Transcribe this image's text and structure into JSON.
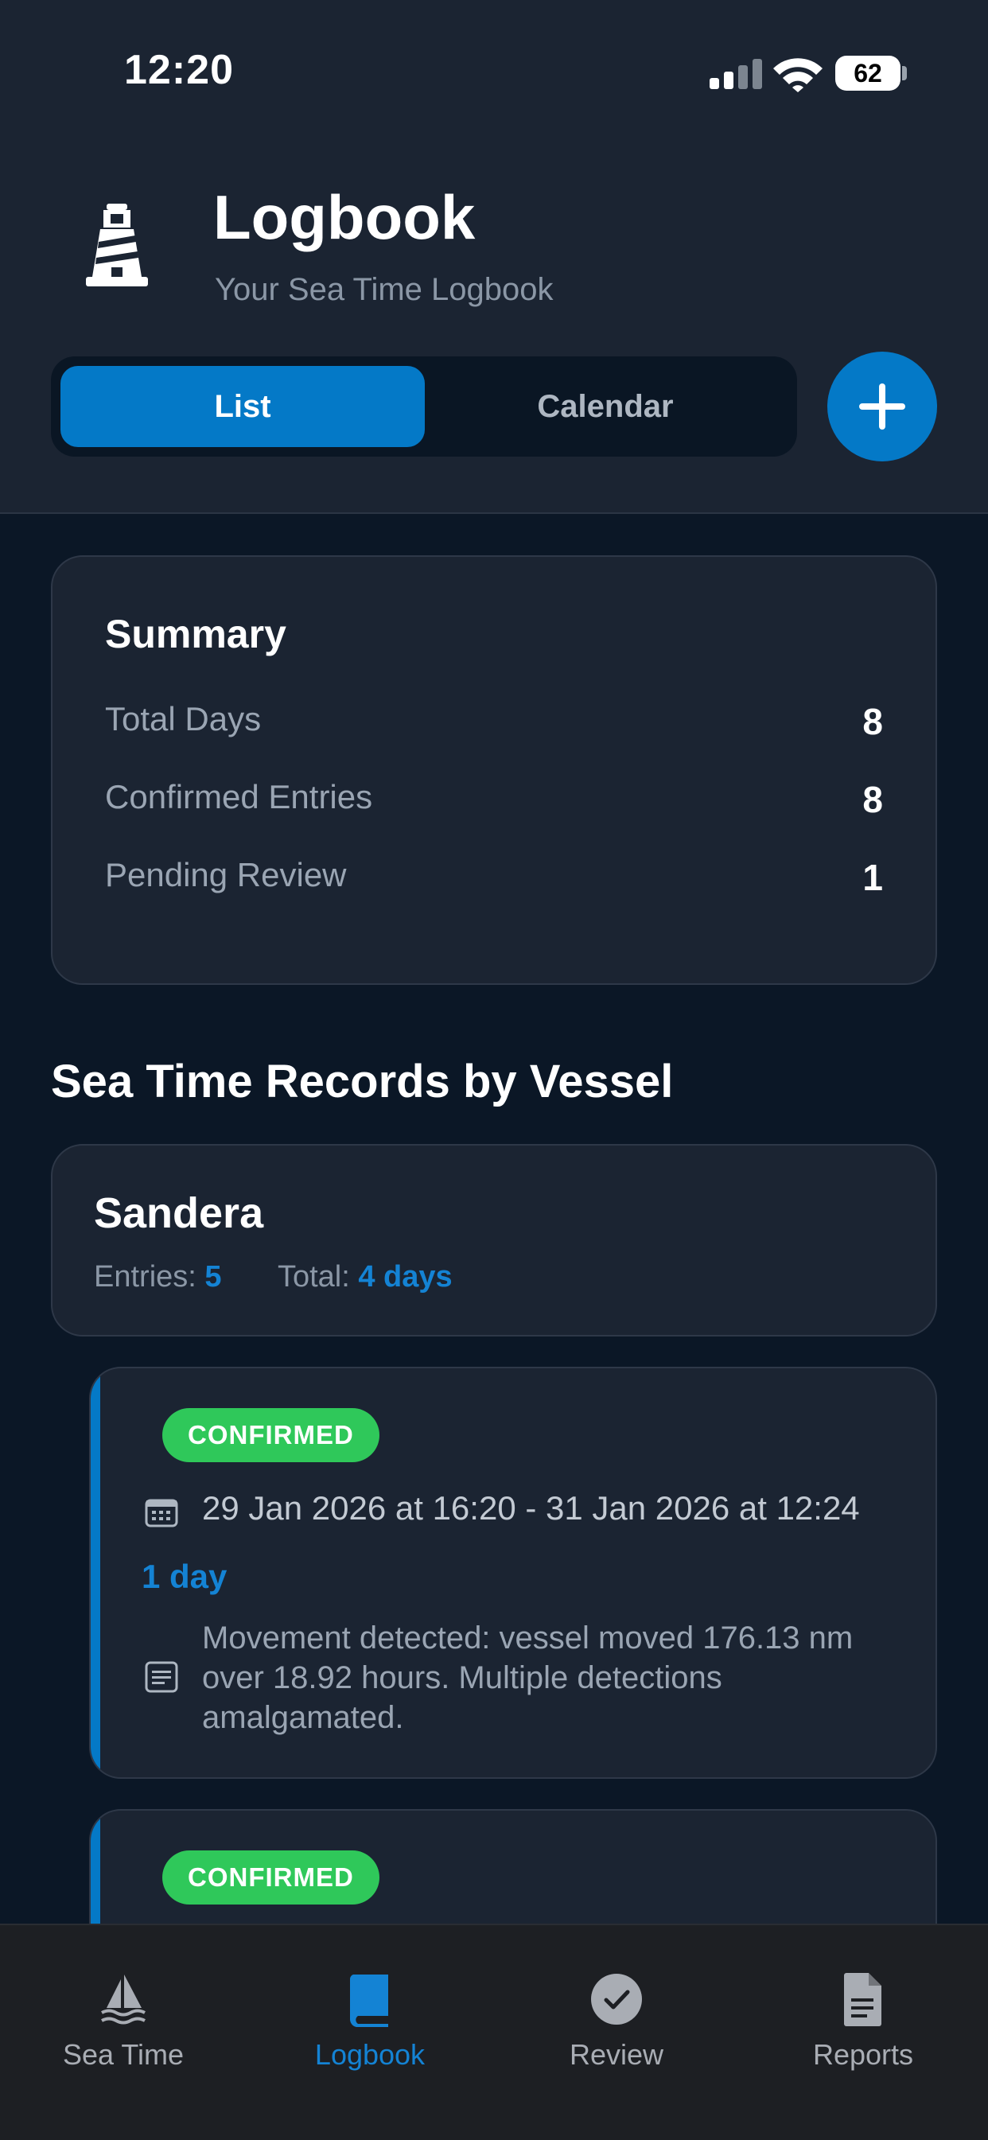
{
  "status_bar": {
    "time": "12:20",
    "battery": "62"
  },
  "header": {
    "title": "Logbook",
    "subtitle": "Your Sea Time Logbook",
    "segments": {
      "list": "List",
      "calendar": "Calendar",
      "active": "List"
    }
  },
  "summary": {
    "title": "Summary",
    "rows": [
      {
        "label": "Total Days",
        "value": "8"
      },
      {
        "label": "Confirmed Entries",
        "value": "8"
      },
      {
        "label": "Pending Review",
        "value": "1"
      }
    ]
  },
  "records": {
    "section_title": "Sea Time Records by Vessel",
    "vessel": {
      "name": "Sandera",
      "entries_label": "Entries:",
      "entries_value": "5",
      "total_label": "Total:",
      "total_value": "4 days"
    },
    "entries": [
      {
        "status": "CONFIRMED",
        "date_range": "29 Jan 2026 at 16:20 - 31 Jan 2026 at 12:24",
        "duration": "1 day",
        "note": "Movement detected: vessel moved 176.13 nm over 18.92 hours. Multiple detections amalgamated."
      },
      {
        "status": "CONFIRMED"
      }
    ]
  },
  "tabbar": {
    "items": [
      {
        "label": "Sea Time",
        "icon": "sailboat-icon"
      },
      {
        "label": "Logbook",
        "icon": "book-icon"
      },
      {
        "label": "Review",
        "icon": "check-circle-icon"
      },
      {
        "label": "Reports",
        "icon": "document-icon"
      }
    ],
    "active": "Logbook"
  },
  "colors": {
    "accent": "#0479c7",
    "confirmed": "#2fc85a",
    "background": "#0b1726",
    "card": "#1b2432"
  }
}
